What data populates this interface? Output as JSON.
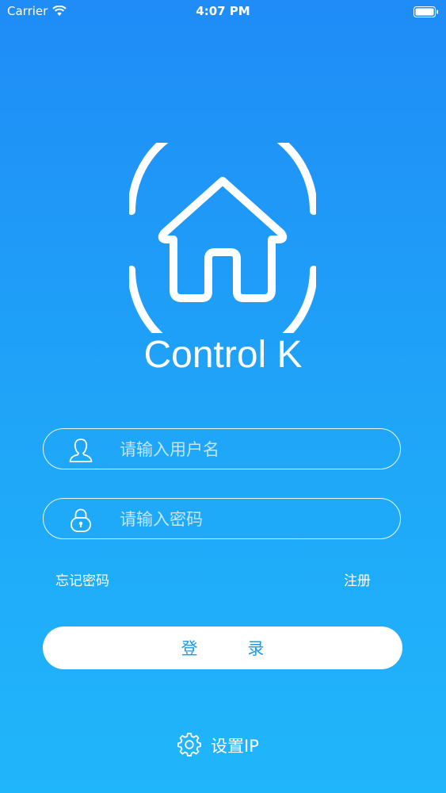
{
  "status_bar": {
    "carrier": "Carrier",
    "time": "4:07 PM",
    "wifi_icon": "wifi-icon",
    "battery_icon": "battery-icon"
  },
  "logo": {
    "icon": "house-logo-icon",
    "app_name": "Control K"
  },
  "form": {
    "username_placeholder": "请输入用户名",
    "username_value": "",
    "username_icon": "user-icon",
    "password_placeholder": "请输入密码",
    "password_value": "",
    "password_icon": "lock-icon",
    "forgot_password": "忘记密码",
    "register": "注册",
    "login_button": "登 录"
  },
  "settings": {
    "icon": "gear-icon",
    "label": "设置IP"
  },
  "colors": {
    "background_top": "#1f8cf7",
    "background_bottom": "#20b6fb",
    "button_text": "#1e99e8",
    "foreground": "#ffffff"
  }
}
